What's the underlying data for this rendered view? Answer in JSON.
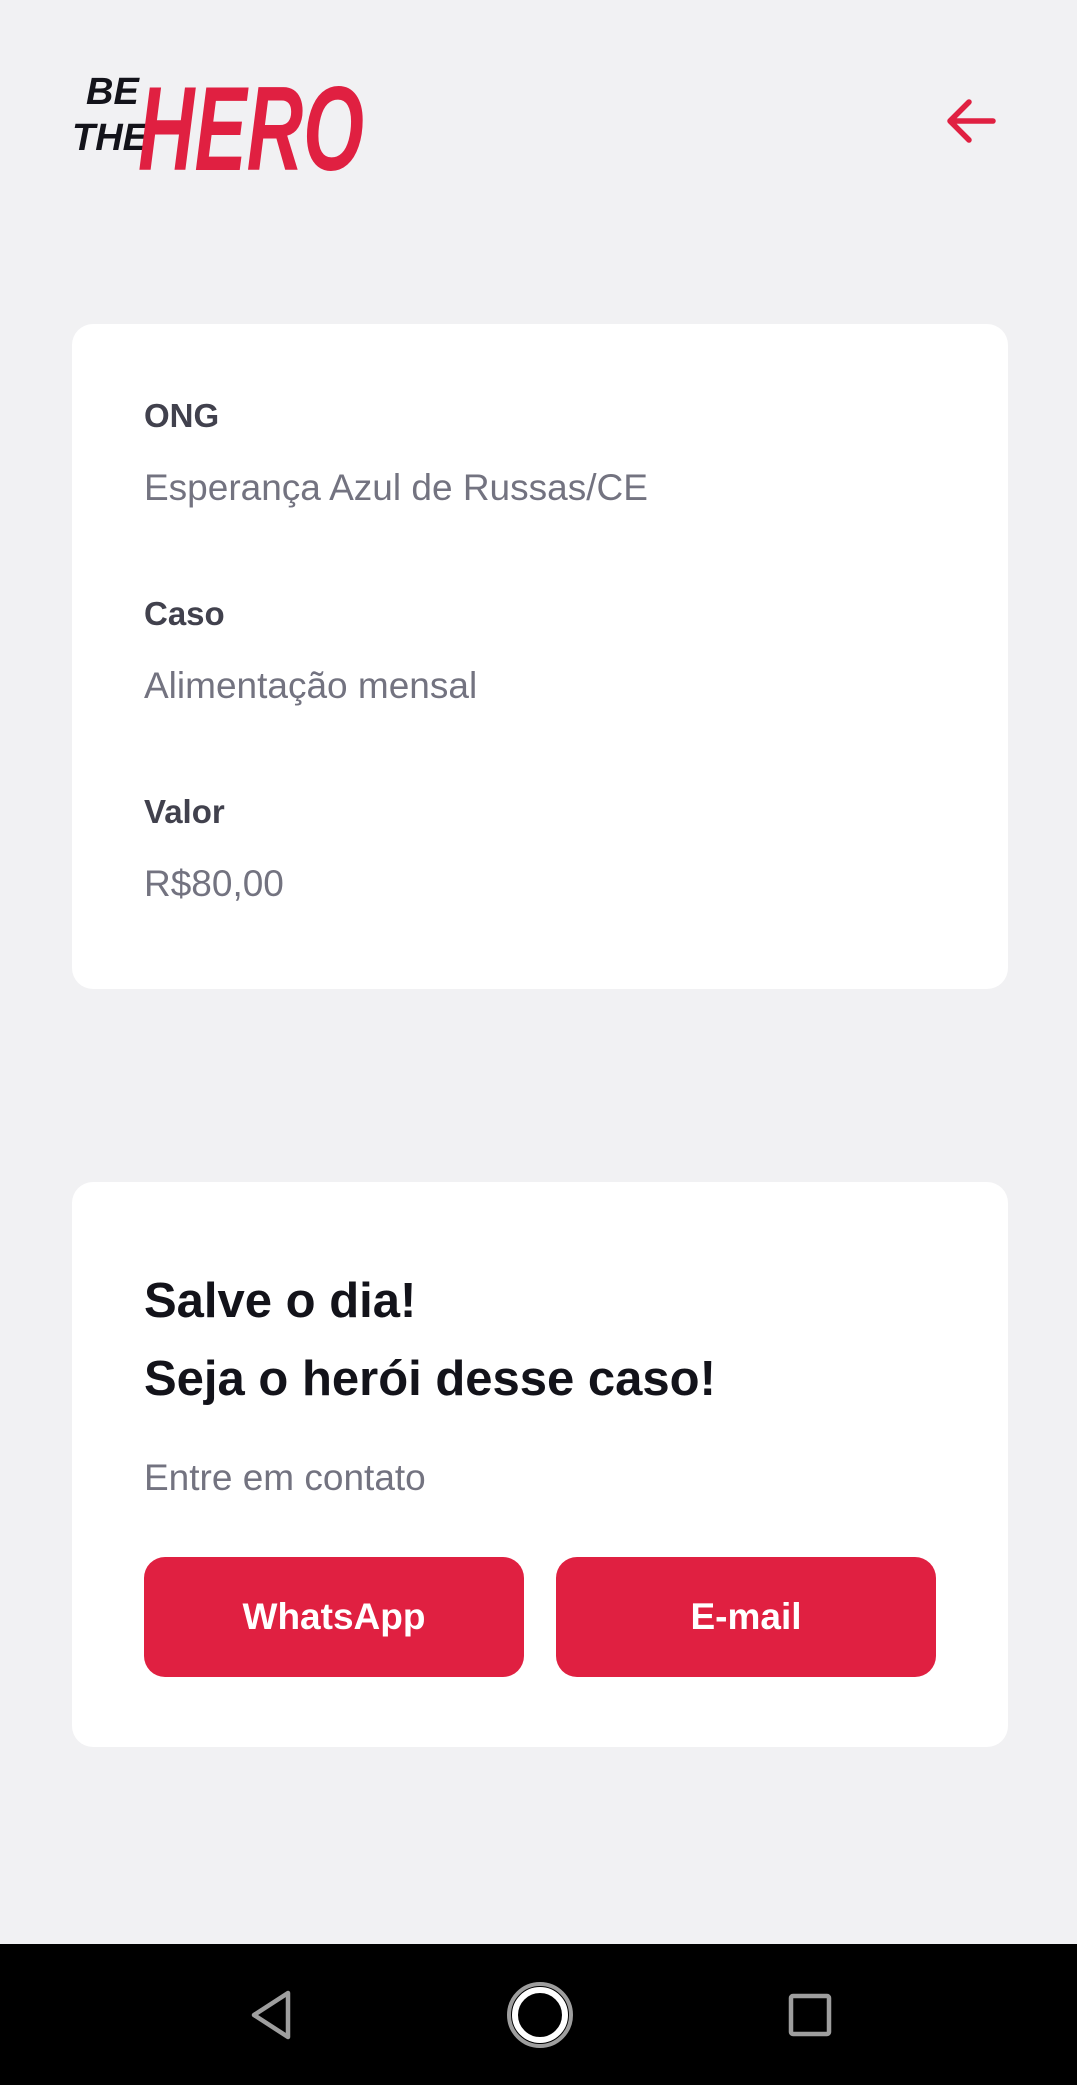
{
  "brand": {
    "line1": "BE",
    "line2": "THE",
    "word": "HERO",
    "accent_color": "#e02041"
  },
  "header": {
    "back_icon": "arrow-left-icon"
  },
  "incident": {
    "ong_label": "ONG",
    "ong_value": "Esperança Azul de Russas/CE",
    "case_label": "Caso",
    "case_value": "Alimentação mensal",
    "value_label": "Valor",
    "value_value": "R$80,00"
  },
  "contact": {
    "title_line1": "Salve o dia!",
    "title_line2": "Seja o herói desse caso!",
    "hint": "Entre em contato",
    "whatsapp_label": "WhatsApp",
    "email_label": "E-mail"
  },
  "system_nav": {
    "back_icon": "triangle-back-icon",
    "home_icon": "circle-home-icon",
    "recents_icon": "square-recents-icon"
  }
}
